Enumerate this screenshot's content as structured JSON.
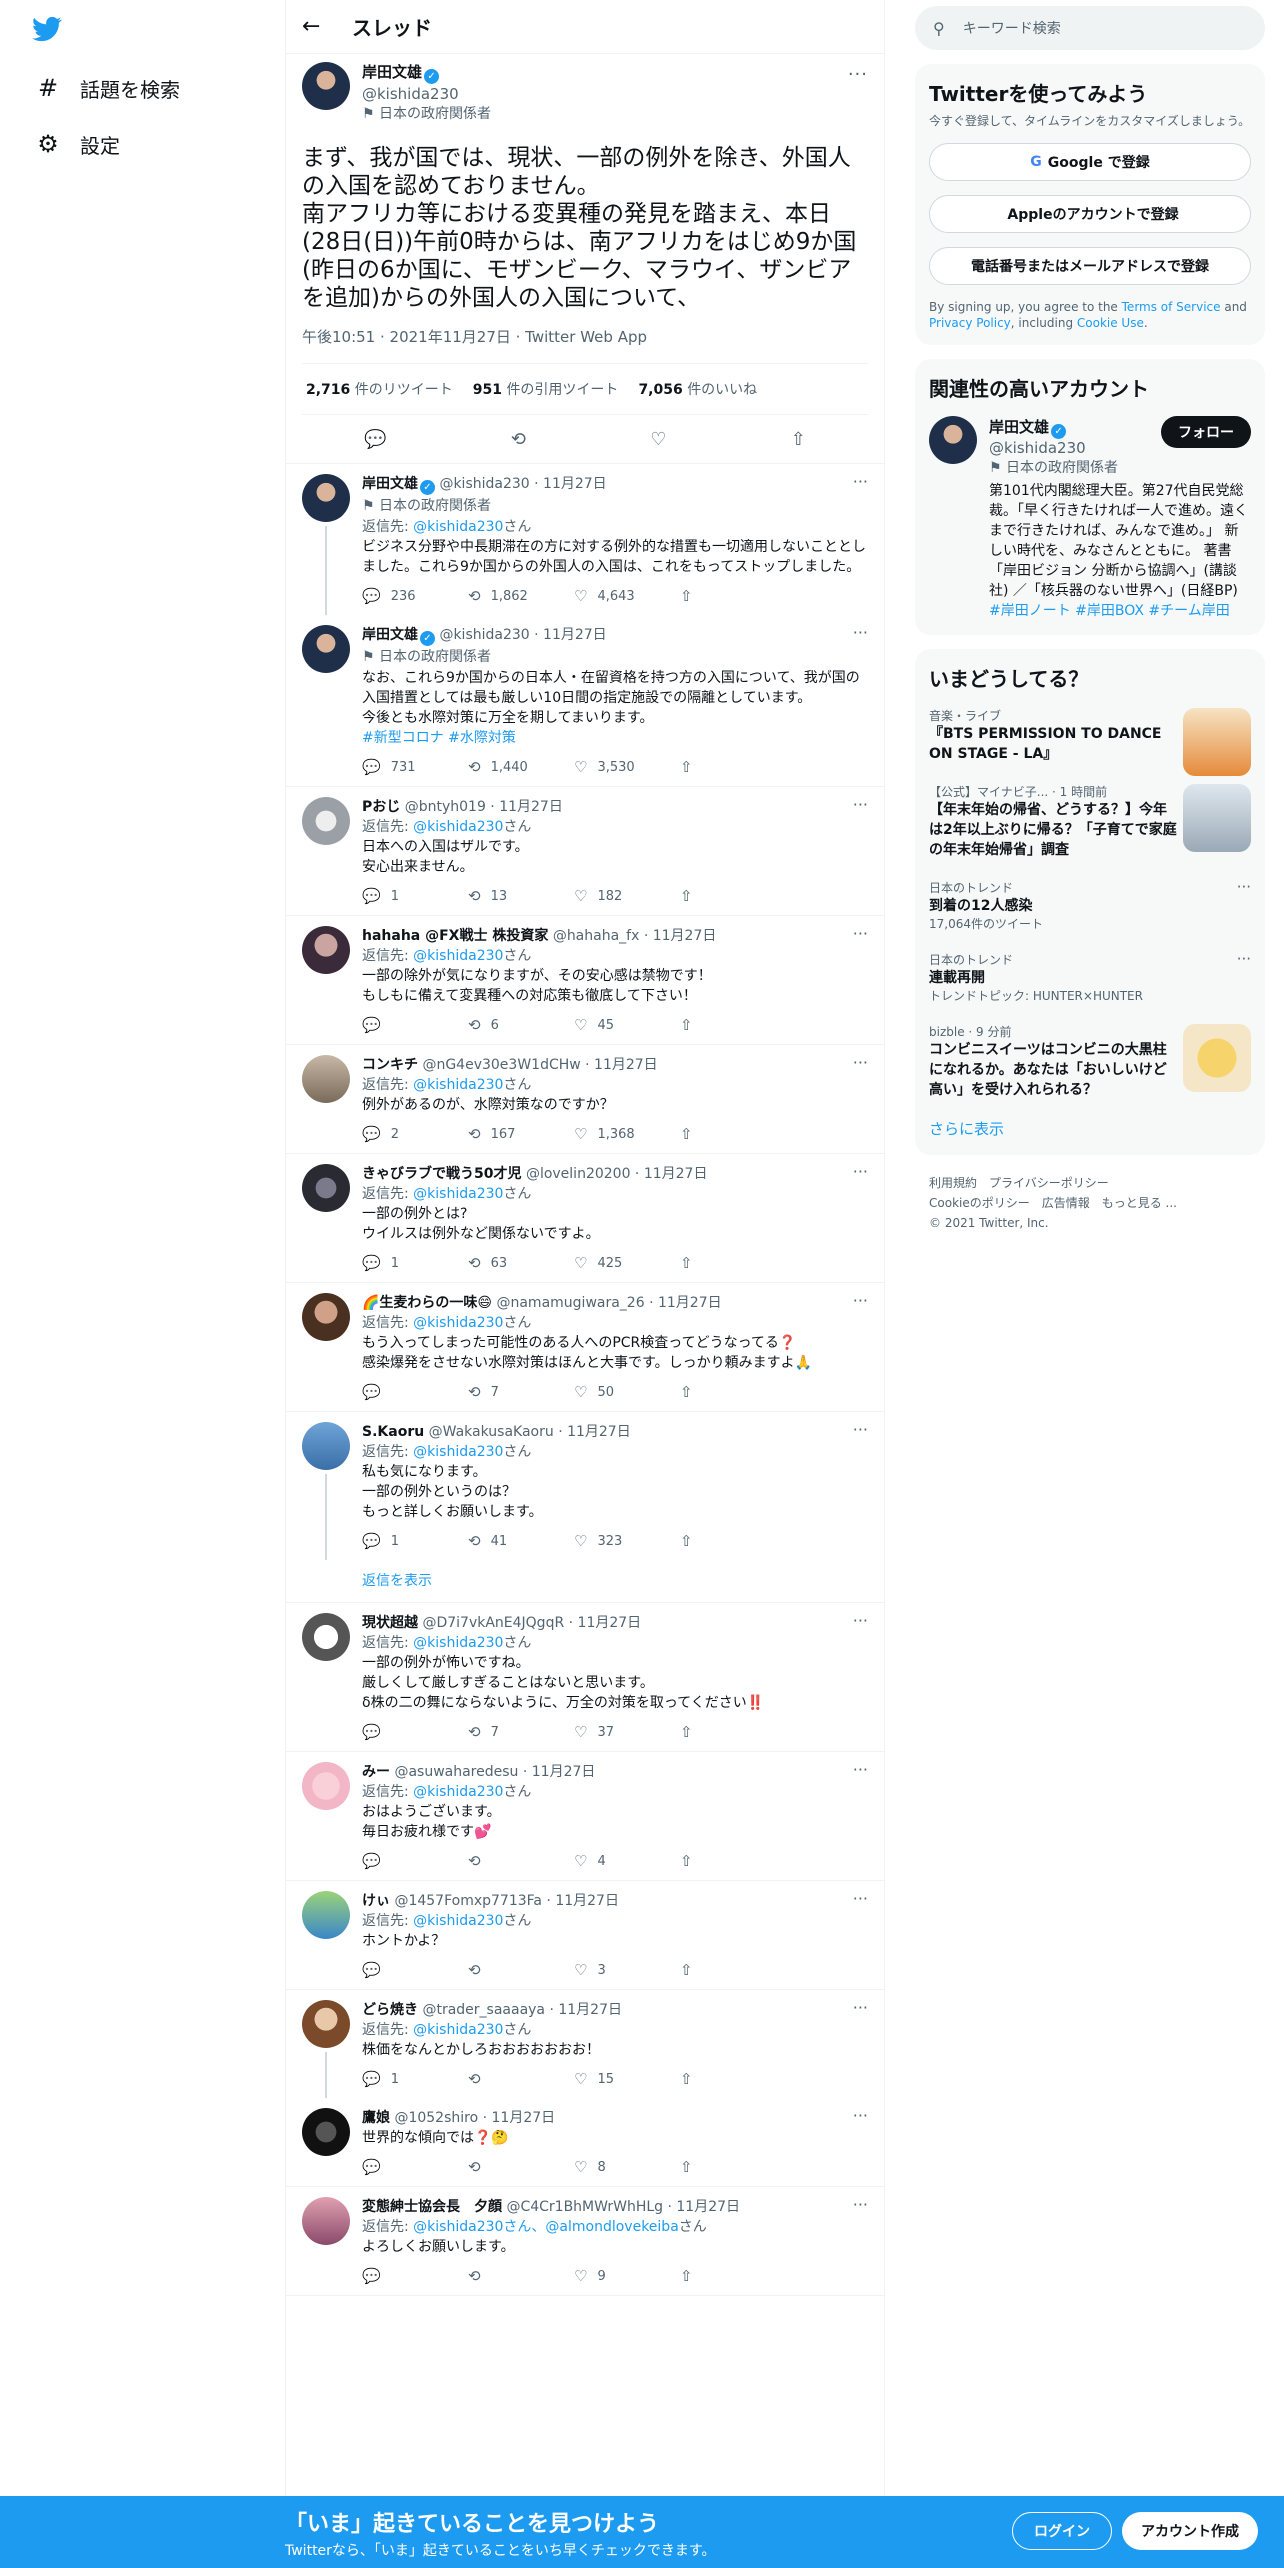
{
  "left_nav": {
    "explore": "話題を検索",
    "settings": "設定"
  },
  "header": {
    "title": "スレッド"
  },
  "main_tweet": {
    "name": "岸田文雄",
    "handle": "@kishida230",
    "gov": "日本の政府関係者",
    "text": "まず、我が国では、現状、一部の例外を除き、外国人の入国を認めておりません。\n南アフリカ等における変異種の発見を踏まえ、本日(28日(日))午前0時からは、南アフリカをはじめ9か国(昨日の6か国に、モザンビーク、マラウイ、ザンビアを追加)からの外国人の入国について、",
    "time": "午後10:51 · 2021年11月27日 · Twitter Web App",
    "retweets": "2,716",
    "retweets_label": "件のリツイート",
    "quotes": "951",
    "quotes_label": "件の引用ツイート",
    "likes": "7,056",
    "likes_label": "件のいいね"
  },
  "replies": [
    {
      "name": "岸田文雄",
      "handle": "@kishida230 · 11月27日",
      "gov": "日本の政府関係者",
      "replying_prefix": "返信先: ",
      "replying_to": "@kishida230",
      "replying_suffix": "さん",
      "text": "ビジネス分野や中長期滞在の方に対する例外的な措置も一切適用しないこととしました。これら9か国からの外国人の入国は、これをもってストップしました。",
      "hashtags": "",
      "reply": "236",
      "rt": "1,862",
      "like": "4,643"
    },
    {
      "name": "岸田文雄",
      "handle": "@kishida230 · 11月27日",
      "gov": "日本の政府関係者",
      "replying_prefix": "",
      "replying_to": "",
      "replying_suffix": "",
      "text": "なお、これら9か国からの日本人・在留資格を持つ方の入国について、我が国の入国措置としては最も厳しい10日間の指定施設での隔離としています。\n今後とも水際対策に万全を期してまいります。",
      "hashtags": "#新型コロナ #水際対策",
      "reply": "731",
      "rt": "1,440",
      "like": "3,530"
    },
    {
      "name": "Pおじ",
      "handle": "@bntyh019 · 11月27日",
      "gov": "",
      "replying_prefix": "返信先: ",
      "replying_to": "@kishida230",
      "replying_suffix": "さん",
      "text": "日本への入国はザルです。\n安心出来ません。",
      "hashtags": "",
      "reply": "1",
      "rt": "13",
      "like": "182"
    },
    {
      "name": "hahaha @FX戦士 株投資家",
      "handle": "@hahaha_fx · 11月27日",
      "gov": "",
      "replying_prefix": "返信先: ",
      "replying_to": "@kishida230",
      "replying_suffix": "さん",
      "text": "一部の除外が気になりますが、その安心感は禁物です！\nもしもに備えて変異種への対応策も徹底して下さい！",
      "hashtags": "",
      "reply": "",
      "rt": "6",
      "like": "45"
    },
    {
      "name": "コンキチ",
      "handle": "@nG4ev30e3W1dCHw · 11月27日",
      "gov": "",
      "replying_prefix": "返信先: ",
      "replying_to": "@kishida230",
      "replying_suffix": "さん",
      "text": "例外があるのが、水際対策なのですか？",
      "hashtags": "",
      "reply": "2",
      "rt": "167",
      "like": "1,368"
    },
    {
      "name": "きゃびラブで戦う50才児",
      "handle": "@lovelin20200 · 11月27日",
      "gov": "",
      "replying_prefix": "返信先: ",
      "replying_to": "@kishida230",
      "replying_suffix": "さん",
      "text": "一部の例外とは?\nウイルスは例外など関係ないですよ。",
      "hashtags": "",
      "reply": "1",
      "rt": "63",
      "like": "425"
    },
    {
      "name": "🌈生麦わらの一味😄",
      "handle": "@namamugiwara_26 · 11月27日",
      "gov": "",
      "replying_prefix": "返信先: ",
      "replying_to": "@kishida230",
      "replying_suffix": "さん",
      "text": "もう入ってしまった可能性のある人へのPCR検査ってどうなってる❓\n感染爆発をさせない水際対策はほんと大事です。しっかり頼みますよ🙏",
      "hashtags": "",
      "reply": "",
      "rt": "7",
      "like": "50"
    },
    {
      "name": "S.Kaoru",
      "handle": "@WakakusaKaoru · 11月27日",
      "gov": "",
      "replying_prefix": "返信先: ",
      "replying_to": "@kishida230",
      "replying_suffix": "さん",
      "text": "私も気になります。\n一部の例外というのは？\nもっと詳しくお願いします。",
      "hashtags": "",
      "reply": "1",
      "rt": "41",
      "like": "323"
    },
    {
      "name": "現状超越",
      "handle": "@D7i7vkAnE4JQgqR · 11月27日",
      "gov": "",
      "replying_prefix": "返信先: ",
      "replying_to": "@kishida230",
      "replying_suffix": "さん",
      "text": "一部の例外が怖いですね。\n厳しくして厳しすぎることはないと思います。\nδ株の二の舞にならないように、万全の対策を取ってください‼️",
      "hashtags": "",
      "reply": "",
      "rt": "7",
      "like": "37"
    },
    {
      "name": "みー",
      "handle": "@asuwaharedesu · 11月27日",
      "gov": "",
      "replying_prefix": "返信先: ",
      "replying_to": "@kishida230",
      "replying_suffix": "さん",
      "text": "おはようございます。\n毎日お疲れ様です💕",
      "hashtags": "",
      "reply": "",
      "rt": "",
      "like": "4"
    },
    {
      "name": "けぃ",
      "handle": "@1457Fomxp7713Fa · 11月27日",
      "gov": "",
      "replying_prefix": "返信先: ",
      "replying_to": "@kishida230",
      "replying_suffix": "さん",
      "text": "ホントかよ？",
      "hashtags": "",
      "reply": "",
      "rt": "",
      "like": "3"
    },
    {
      "name": "どら焼き",
      "handle": "@trader_saaaaya · 11月27日",
      "gov": "",
      "replying_prefix": "返信先: ",
      "replying_to": "@kishida230",
      "replying_suffix": "さん",
      "text": "株価をなんとかしろおおおおおおお！",
      "hashtags": "",
      "reply": "1",
      "rt": "",
      "like": "15"
    },
    {
      "name": "鷹娘",
      "handle": "@1052shiro · 11月27日",
      "gov": "",
      "replying_prefix": "",
      "replying_to": "",
      "replying_suffix": "",
      "text": "世界的な傾向では❓🤔",
      "hashtags": "",
      "reply": "",
      "rt": "",
      "like": "8"
    },
    {
      "name": "変態紳士協会長　夕顔",
      "handle": "@C4Cr1BhMWrWhHLg · 11月27日",
      "gov": "",
      "replying_prefix": "返信先: ",
      "replying_to": "@kishida230さん、@almondlovekeiba",
      "replying_suffix": "さん",
      "text": "よろしくお願いします。",
      "hashtags": "",
      "reply": "",
      "rt": "",
      "like": "9"
    }
  ],
  "show_replies": "返信を表示",
  "search": {
    "placeholder": "キーワード検索"
  },
  "signup_card": {
    "title": "Twitterを使ってみよう",
    "sub": "今すぐ登録して、タイムラインをカスタマイズしましょう。",
    "google": "Google で登録",
    "apple": "Appleのアカウントで登録",
    "phone": "電話番号またはメールアドレスで登録",
    "legal_1": "By signing up, you agree to the ",
    "tos": "Terms of Service",
    "legal_2": " and ",
    "privacy": "Privacy Policy",
    "legal_3": ", including ",
    "cookie": "Cookie Use",
    "legal_4": "."
  },
  "related": {
    "title": "関連性の高いアカウント",
    "name": "岸田文雄",
    "handle": "@kishida230",
    "gov": "日本の政府関係者",
    "follow": "フォロー",
    "bio": "第101代内閣総理大臣。第27代自民党総裁。「早く行きたければ一人で進め。遠くまで行きたければ、みんなで進め。」 新しい時代を、みなさんとともに。 著書「岸田ビジョン 分断から協調へ」(講談社) ／「核兵器のない世界へ」(日経BP) ",
    "bio_tags": "#岸田ノート #岸田BOX #チーム岸田"
  },
  "trends": {
    "title": "いまどうしてる？",
    "items": [
      {
        "meta": "音楽・ライブ",
        "title": "『BTS PERMISSION TO DANCE ON STAGE - LA』",
        "extra": ""
      },
      {
        "meta": "【公式】マイナビ子... · 1 時間前",
        "title": "【年末年始の帰省、どうする？】今年は2年以上ぶりに帰る？「子育てで家庭の年末年始帰省」調査",
        "extra": ""
      },
      {
        "meta": "日本のトレンド",
        "title": "到着の12人感染",
        "extra": "17,064件のツイート"
      },
      {
        "meta": "日本のトレンド",
        "title": "連載再開",
        "extra": "トレンドトピック: HUNTER×HUNTER"
      },
      {
        "meta": "bizble · 9 分前",
        "title": "コンビニスイーツはコンビニの大黒柱になれるか。あなたは「おいしいけど高い」を受け入れられる？",
        "extra": ""
      }
    ],
    "more": "さらに表示"
  },
  "footer": {
    "l1": "利用規約　プライバシーポリシー",
    "l2": "Cookieのポリシー　広告情報　もっと見る ...",
    "l3": "© 2021 Twitter, Inc."
  },
  "bottom_bar": {
    "title": "「いま」起きていることを見つけよう",
    "sub": "Twitterなら、「いま」起きていることをいち早くチェックできます。",
    "login": "ログイン",
    "signup": "アカウント作成"
  },
  "colors": {
    "accent": "#1d9bf0",
    "text": "#0f1419",
    "muted": "#536471"
  }
}
